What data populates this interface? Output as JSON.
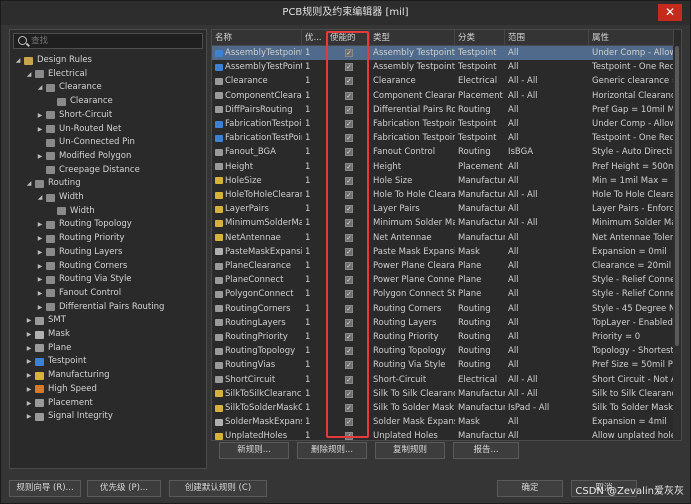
{
  "window": {
    "title": "PCB规则及约束编辑器 [mil]",
    "close_glyph": "✕"
  },
  "search": {
    "placeholder": "查找"
  },
  "tree": [
    {
      "label": "Design Rules",
      "level": 0,
      "expand": "open",
      "icon": "folder-icon",
      "color": "#c8a44a"
    },
    {
      "label": "Electrical",
      "level": 1,
      "expand": "open",
      "icon": "electrical-icon",
      "color": "#8a8a8a"
    },
    {
      "label": "Clearance",
      "level": 2,
      "expand": "open",
      "icon": "clearance-icon",
      "color": "#8a8a8a"
    },
    {
      "label": "Clearance",
      "level": 3,
      "expand": "none",
      "icon": "clearance-icon",
      "color": "#8a8a8a"
    },
    {
      "label": "Short-Circuit",
      "level": 2,
      "expand": "closed",
      "icon": "short-circuit-icon",
      "color": "#8a8a8a"
    },
    {
      "label": "Un-Routed Net",
      "level": 2,
      "expand": "closed",
      "icon": "unrouted-net-icon",
      "color": "#8a8a8a"
    },
    {
      "label": "Un-Connected Pin",
      "level": 2,
      "expand": "none",
      "icon": "unconnected-pin-icon",
      "color": "#8a8a8a"
    },
    {
      "label": "Modified Polygon",
      "level": 2,
      "expand": "closed",
      "icon": "modified-polygon-icon",
      "color": "#8a8a8a"
    },
    {
      "label": "Creepage Distance",
      "level": 2,
      "expand": "none",
      "icon": "creepage-icon",
      "color": "#8a8a8a"
    },
    {
      "label": "Routing",
      "level": 1,
      "expand": "open",
      "icon": "routing-icon",
      "color": "#8a8a8a"
    },
    {
      "label": "Width",
      "level": 2,
      "expand": "open",
      "icon": "width-icon",
      "color": "#8a8a8a"
    },
    {
      "label": "Width",
      "level": 3,
      "expand": "none",
      "icon": "width-icon",
      "color": "#8a8a8a"
    },
    {
      "label": "Routing Topology",
      "level": 2,
      "expand": "closed",
      "icon": "routing-topology-icon",
      "color": "#8a8a8a"
    },
    {
      "label": "Routing Priority",
      "level": 2,
      "expand": "closed",
      "icon": "routing-priority-icon",
      "color": "#8a8a8a"
    },
    {
      "label": "Routing Layers",
      "level": 2,
      "expand": "closed",
      "icon": "routing-layers-icon",
      "color": "#8a8a8a"
    },
    {
      "label": "Routing Corners",
      "level": 2,
      "expand": "closed",
      "icon": "routing-corners-icon",
      "color": "#8a8a8a"
    },
    {
      "label": "Routing Via Style",
      "level": 2,
      "expand": "closed",
      "icon": "via-style-icon",
      "color": "#8a8a8a"
    },
    {
      "label": "Fanout Control",
      "level": 2,
      "expand": "closed",
      "icon": "fanout-icon",
      "color": "#8a8a8a"
    },
    {
      "label": "Differential Pairs Routing",
      "level": 2,
      "expand": "closed",
      "icon": "diff-pairs-icon",
      "color": "#8a8a8a"
    },
    {
      "label": "SMT",
      "level": 1,
      "expand": "closed",
      "icon": "smt-icon",
      "color": "#9a9a9a"
    },
    {
      "label": "Mask",
      "level": 1,
      "expand": "closed",
      "icon": "mask-icon",
      "color": "#b0b0b0"
    },
    {
      "label": "Plane",
      "level": 1,
      "expand": "closed",
      "icon": "plane-icon",
      "color": "#9a9a9a"
    },
    {
      "label": "Testpoint",
      "level": 1,
      "expand": "closed",
      "icon": "testpoint-icon",
      "color": "#3b82d6"
    },
    {
      "label": "Manufacturing",
      "level": 1,
      "expand": "closed",
      "icon": "manufacturing-icon",
      "color": "#d6b23b"
    },
    {
      "label": "High Speed",
      "level": 1,
      "expand": "closed",
      "icon": "high-speed-icon",
      "color": "#d67a2b"
    },
    {
      "label": "Placement",
      "level": 1,
      "expand": "closed",
      "icon": "placement-icon",
      "color": "#9a9a9a"
    },
    {
      "label": "Signal Integrity",
      "level": 1,
      "expand": "closed",
      "icon": "signal-integrity-icon",
      "color": "#9a9a9a"
    }
  ],
  "table": {
    "columns": [
      "名称",
      "优...",
      "使能的",
      "类型",
      "分类",
      "范围",
      "属性"
    ],
    "rows": [
      {
        "name": "AssemblyTestpoint",
        "prio": "1",
        "type": "Assembly Testpoint St",
        "cat": "Testpoint",
        "scope": "All",
        "attr": "Under Comp - Allow",
        "icon": "testpoint-icon",
        "color": "#3b82d6",
        "sel": true
      },
      {
        "name": "AssemblyTestPointU",
        "prio": "1",
        "type": "Assembly Testpoint U",
        "cat": "Testpoint",
        "scope": "All",
        "attr": "Testpoint - One Requ",
        "icon": "testpoint-icon",
        "color": "#3b82d6"
      },
      {
        "name": "Clearance",
        "prio": "1",
        "type": "Clearance",
        "cat": "Electrical",
        "scope": "All    -   All",
        "attr": "Generic clearance =",
        "icon": "clearance-icon",
        "color": "#9a9a9a"
      },
      {
        "name": "ComponentClearanc",
        "prio": "1",
        "type": "Component Clearance",
        "cat": "Placement",
        "scope": "All    -   All",
        "attr": "Horizontal Clearance",
        "icon": "component-clearance-icon",
        "color": "#9a9a9a"
      },
      {
        "name": "DiffPairsRouting",
        "prio": "1",
        "type": "Differential Pairs Rout",
        "cat": "Routing",
        "scope": "All",
        "attr": "Pref Gap = 10mil  M",
        "icon": "diff-pairs-icon",
        "color": "#9a9a9a"
      },
      {
        "name": "FabricationTestpoint",
        "prio": "1",
        "type": "Fabrication Testpoint",
        "cat": "Testpoint",
        "scope": "All",
        "attr": "Under Comp - Allow",
        "icon": "testpoint-icon",
        "color": "#3b82d6"
      },
      {
        "name": "FabricationTestPoint",
        "prio": "1",
        "type": "Fabrication Testpoint",
        "cat": "Testpoint",
        "scope": "All",
        "attr": "Testpoint - One Requ",
        "icon": "testpoint-icon",
        "color": "#3b82d6"
      },
      {
        "name": "Fanout_BGA",
        "prio": "1",
        "type": "Fanout Control",
        "cat": "Routing",
        "scope": "IsBGA",
        "attr": "Style - Auto  Directi",
        "icon": "fanout-icon",
        "color": "#9a9a9a"
      },
      {
        "name": "Height",
        "prio": "1",
        "type": "Height",
        "cat": "Placement",
        "scope": "All",
        "attr": "Pref Height = 500mil",
        "icon": "height-icon",
        "color": "#9a9a9a"
      },
      {
        "name": "HoleSize",
        "prio": "1",
        "type": "Hole Size",
        "cat": "Manufacturir",
        "scope": "All",
        "attr": "Min = 1mil   Max =",
        "icon": "manufacturing-icon",
        "color": "#d6b23b"
      },
      {
        "name": "HoleToHoleClearanc",
        "prio": "1",
        "type": "Hole To Hole Clearanc",
        "cat": "Manufacturir",
        "scope": "All    -   All",
        "attr": "Hole To Hole Clearan",
        "icon": "manufacturing-icon",
        "color": "#d6b23b"
      },
      {
        "name": "LayerPairs",
        "prio": "1",
        "type": "Layer Pairs",
        "cat": "Manufacturir",
        "scope": "All",
        "attr": "Layer Pairs - Enforce",
        "icon": "manufacturing-icon",
        "color": "#d6b23b"
      },
      {
        "name": "MinimumSolderMask",
        "prio": "1",
        "type": "Minimum Solder Mask",
        "cat": "Manufacturir",
        "scope": "All    -   All",
        "attr": "Minimum Solder Mask",
        "icon": "manufacturing-icon",
        "color": "#d6b23b"
      },
      {
        "name": "NetAntennae",
        "prio": "1",
        "type": "Net Antennae",
        "cat": "Manufacturir",
        "scope": "All",
        "attr": "Net Antennae Tolerai",
        "icon": "manufacturing-icon",
        "color": "#d6b23b"
      },
      {
        "name": "PasteMaskExpansion",
        "prio": "1",
        "type": "Paste Mask Expansion",
        "cat": "Mask",
        "scope": "All",
        "attr": "Expansion = 0mil",
        "icon": "mask-icon",
        "color": "#b0b0b0"
      },
      {
        "name": "PlaneClearance",
        "prio": "1",
        "type": "Power Plane Clearanc",
        "cat": "Plane",
        "scope": "All",
        "attr": "Clearance = 20mil",
        "icon": "plane-icon",
        "color": "#9a9a9a"
      },
      {
        "name": "PlaneConnect",
        "prio": "1",
        "type": "Power Plane Connect",
        "cat": "Plane",
        "scope": "All",
        "attr": "Style - Relief Connec",
        "icon": "plane-icon",
        "color": "#9a9a9a"
      },
      {
        "name": "PolygonConnect",
        "prio": "1",
        "type": "Polygon Connect Styl",
        "cat": "Plane",
        "scope": "All",
        "attr": "Style - Relief Connec",
        "icon": "plane-icon",
        "color": "#9a9a9a"
      },
      {
        "name": "RoutingCorners",
        "prio": "1",
        "type": "Routing Corners",
        "cat": "Routing",
        "scope": "All",
        "attr": "Style - 45 Degree  N",
        "icon": "routing-corners-icon",
        "color": "#9a9a9a"
      },
      {
        "name": "RoutingLayers",
        "prio": "1",
        "type": "Routing Layers",
        "cat": "Routing",
        "scope": "All",
        "attr": "TopLayer - Enabled B",
        "icon": "routing-layers-icon",
        "color": "#9a9a9a"
      },
      {
        "name": "RoutingPriority",
        "prio": "1",
        "type": "Routing Priority",
        "cat": "Routing",
        "scope": "All",
        "attr": "Priority = 0",
        "icon": "routing-priority-icon",
        "color": "#9a9a9a"
      },
      {
        "name": "RoutingTopology",
        "prio": "1",
        "type": "Routing Topology",
        "cat": "Routing",
        "scope": "All",
        "attr": "Topology - Shortest",
        "icon": "routing-topology-icon",
        "color": "#9a9a9a"
      },
      {
        "name": "RoutingVias",
        "prio": "1",
        "type": "Routing Via Style",
        "cat": "Routing",
        "scope": "All",
        "attr": "Pref Size = 50mil  P",
        "icon": "via-style-icon",
        "color": "#9a9a9a"
      },
      {
        "name": "ShortCircuit",
        "prio": "1",
        "type": "Short-Circuit",
        "cat": "Electrical",
        "scope": "All    -   All",
        "attr": "Short Circuit - Not Al",
        "icon": "short-circuit-icon",
        "color": "#9a9a9a"
      },
      {
        "name": "SilkToSilkClearance",
        "prio": "1",
        "type": "Silk To Silk Clearance",
        "cat": "Manufacturir",
        "scope": "All    -   All",
        "attr": "Silk to Silk Clearance",
        "icon": "manufacturing-icon",
        "color": "#d6b23b"
      },
      {
        "name": "SilkToSolderMaskCle",
        "prio": "1",
        "type": "Silk To Solder Mask C",
        "cat": "Manufacturir",
        "scope": "IsPad    -   All",
        "attr": "Silk To Solder Mask C",
        "icon": "manufacturing-icon",
        "color": "#d6b23b"
      },
      {
        "name": "SolderMaskExpansion",
        "prio": "1",
        "type": "Solder Mask Expansion",
        "cat": "Mask",
        "scope": "All",
        "attr": "Expansion = 4mil",
        "icon": "mask-icon",
        "color": "#b0b0b0"
      },
      {
        "name": "UnplatedHoles",
        "prio": "1",
        "type": "Unplated Holes",
        "cat": "Manufacturir",
        "scope": "All",
        "attr": "Allow unplated holes",
        "icon": "manufacturing-icon",
        "color": "#d6b23b"
      }
    ]
  },
  "actions": {
    "new_rule": "新规则...",
    "delete_rule": "删除规则...",
    "copy_rule": "复制规则",
    "report": "报告..."
  },
  "footer": {
    "rule_wizard": "规则向导 (R)...",
    "priorities": "优先级 (P)...",
    "create_default": "创建默认规则 (C)",
    "ok": "确定",
    "cancel": "取消"
  },
  "watermark": "CSDN @Zevalin爱灰灰",
  "colors": {
    "selection": "#4f6a8a",
    "highlight_box": "#e5393b",
    "close": "#c42b1c"
  }
}
